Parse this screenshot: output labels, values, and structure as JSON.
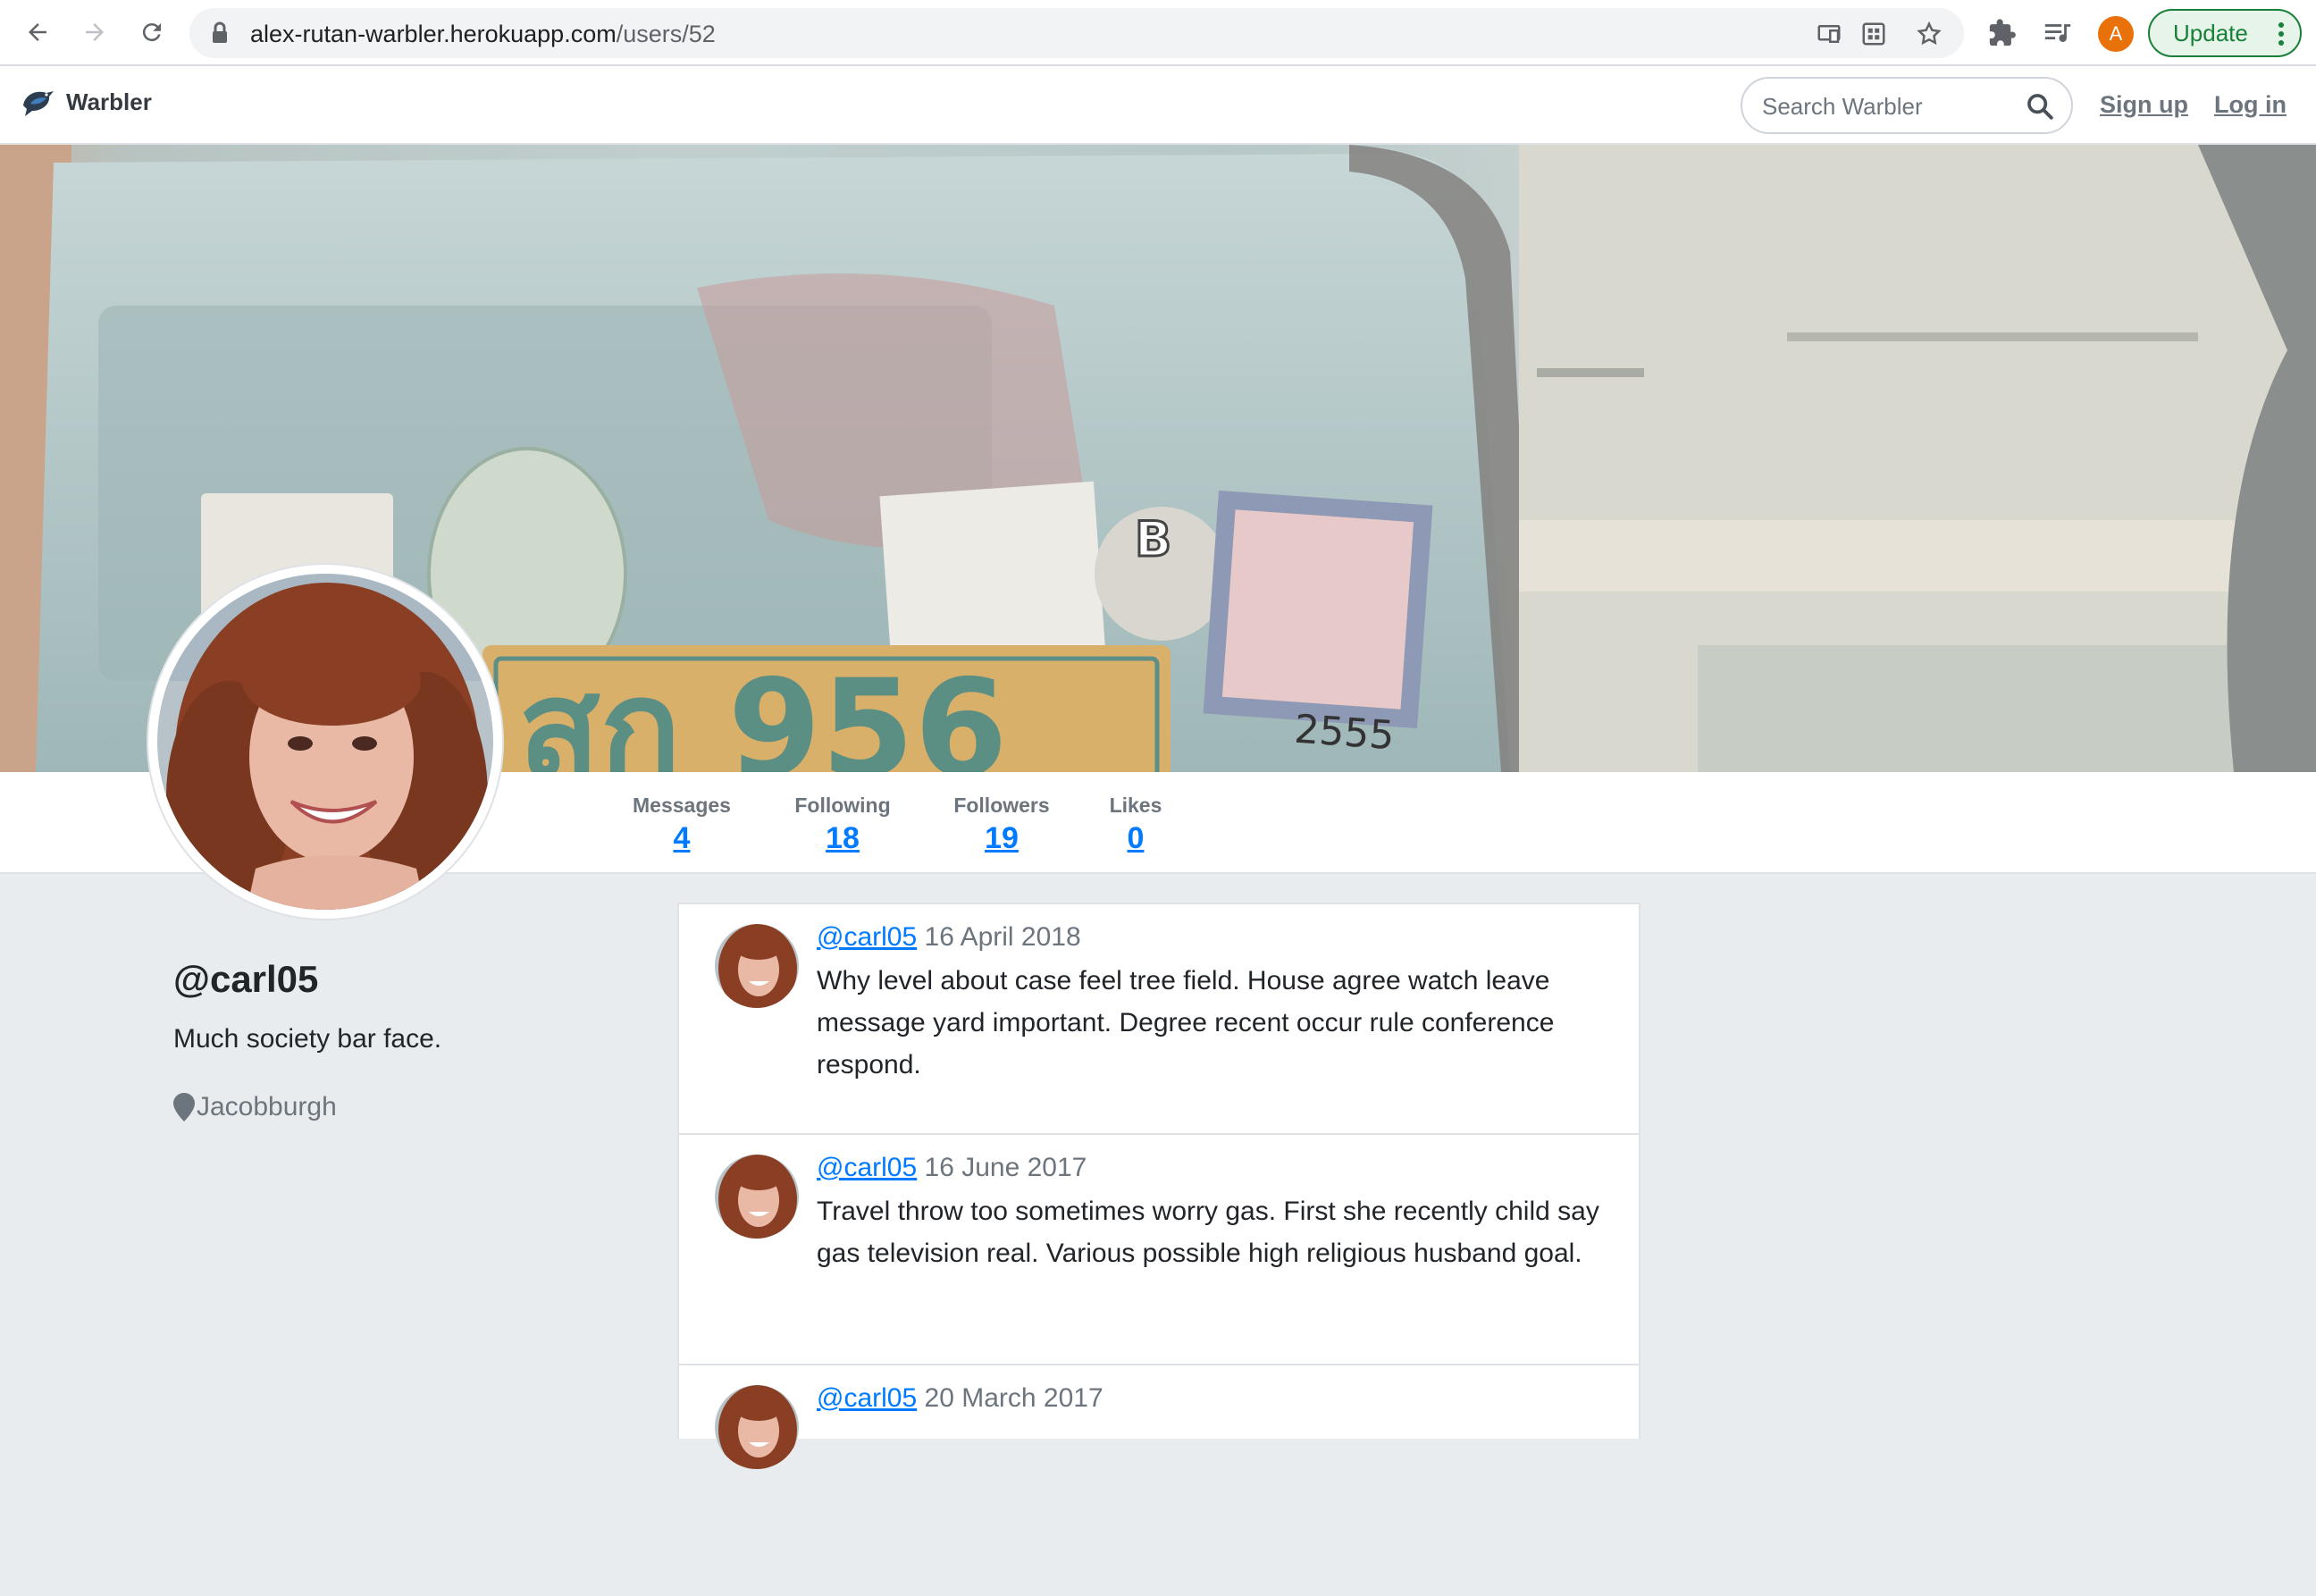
{
  "browser": {
    "url_host": "alex-rutan-warbler.herokuapp.com",
    "url_path": "/users/52",
    "profile_initial": "A",
    "update_label": "Update"
  },
  "navbar": {
    "brand": "Warbler",
    "search_placeholder": "Search Warbler",
    "signup": "Sign up",
    "login": "Log in"
  },
  "stats": [
    {
      "label": "Messages",
      "value": "4"
    },
    {
      "label": "Following",
      "value": "18"
    },
    {
      "label": "Followers",
      "value": "19"
    },
    {
      "label": "Likes",
      "value": "0"
    }
  ],
  "profile": {
    "username": "@carl05",
    "bio": "Much society bar face.",
    "location": "Jacobburgh"
  },
  "hero_plate_text": {
    "plate": "สก 956",
    "badge": "B",
    "sticker": "2555"
  },
  "messages": [
    {
      "user": "@carl05",
      "date": "16 April 2018",
      "text": "Why level about case feel tree field. House agree watch leave message yard important. Degree recent occur rule conference respond."
    },
    {
      "user": "@carl05",
      "date": "16 June 2017",
      "text": "Travel throw too sometimes worry gas. First she recently child say gas television real. Various possible high religious husband goal."
    },
    {
      "user": "@carl05",
      "date": "20 March 2017",
      "text": ""
    }
  ]
}
